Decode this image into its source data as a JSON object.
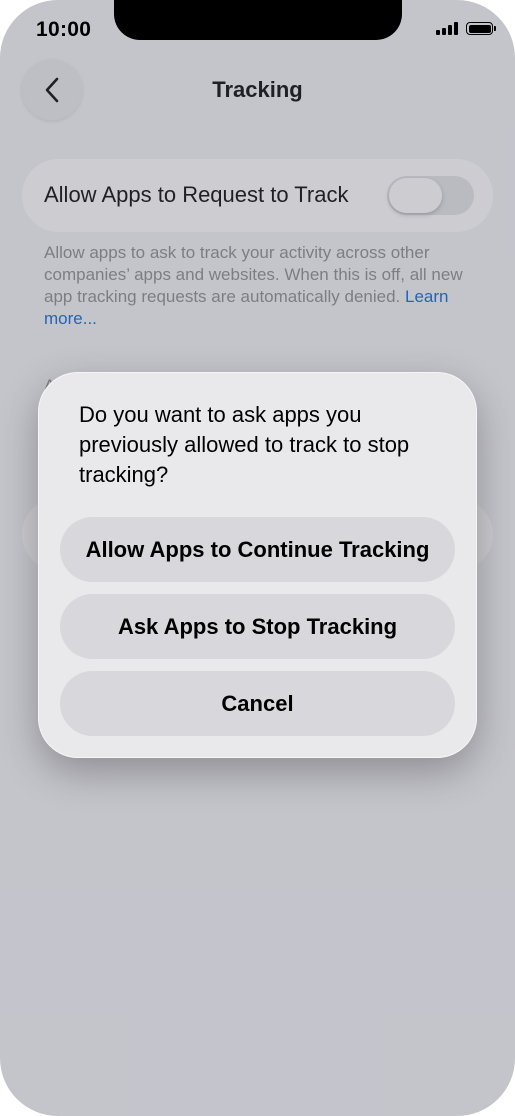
{
  "status_bar": {
    "time": "10:00",
    "signal_icon": "cellular-signal-icon",
    "battery_icon": "battery-full-icon"
  },
  "nav": {
    "back_icon": "chevron-left-icon",
    "title": "Tracking"
  },
  "settings": {
    "toggle_label": "Allow Apps to Request to Track",
    "toggle_state": "off",
    "description": "Allow apps to ask to track your activity across other companies’ apps and websites. When this is off, all new app tracking requests are automatically denied.",
    "learn_more": "Learn more...",
    "partial_letter": "A"
  },
  "alert": {
    "message": "Do you want to ask apps you previously allowed to track to stop tracking?",
    "buttons": [
      {
        "label": "Allow Apps to Continue Tracking"
      },
      {
        "label": "Ask Apps to Stop Tracking"
      },
      {
        "label": "Cancel"
      }
    ]
  },
  "colors": {
    "link": "#0a63d6",
    "background": "#f2f2f7",
    "alert_background": "#e9e9ec",
    "alert_button": "#d7d7dc"
  }
}
